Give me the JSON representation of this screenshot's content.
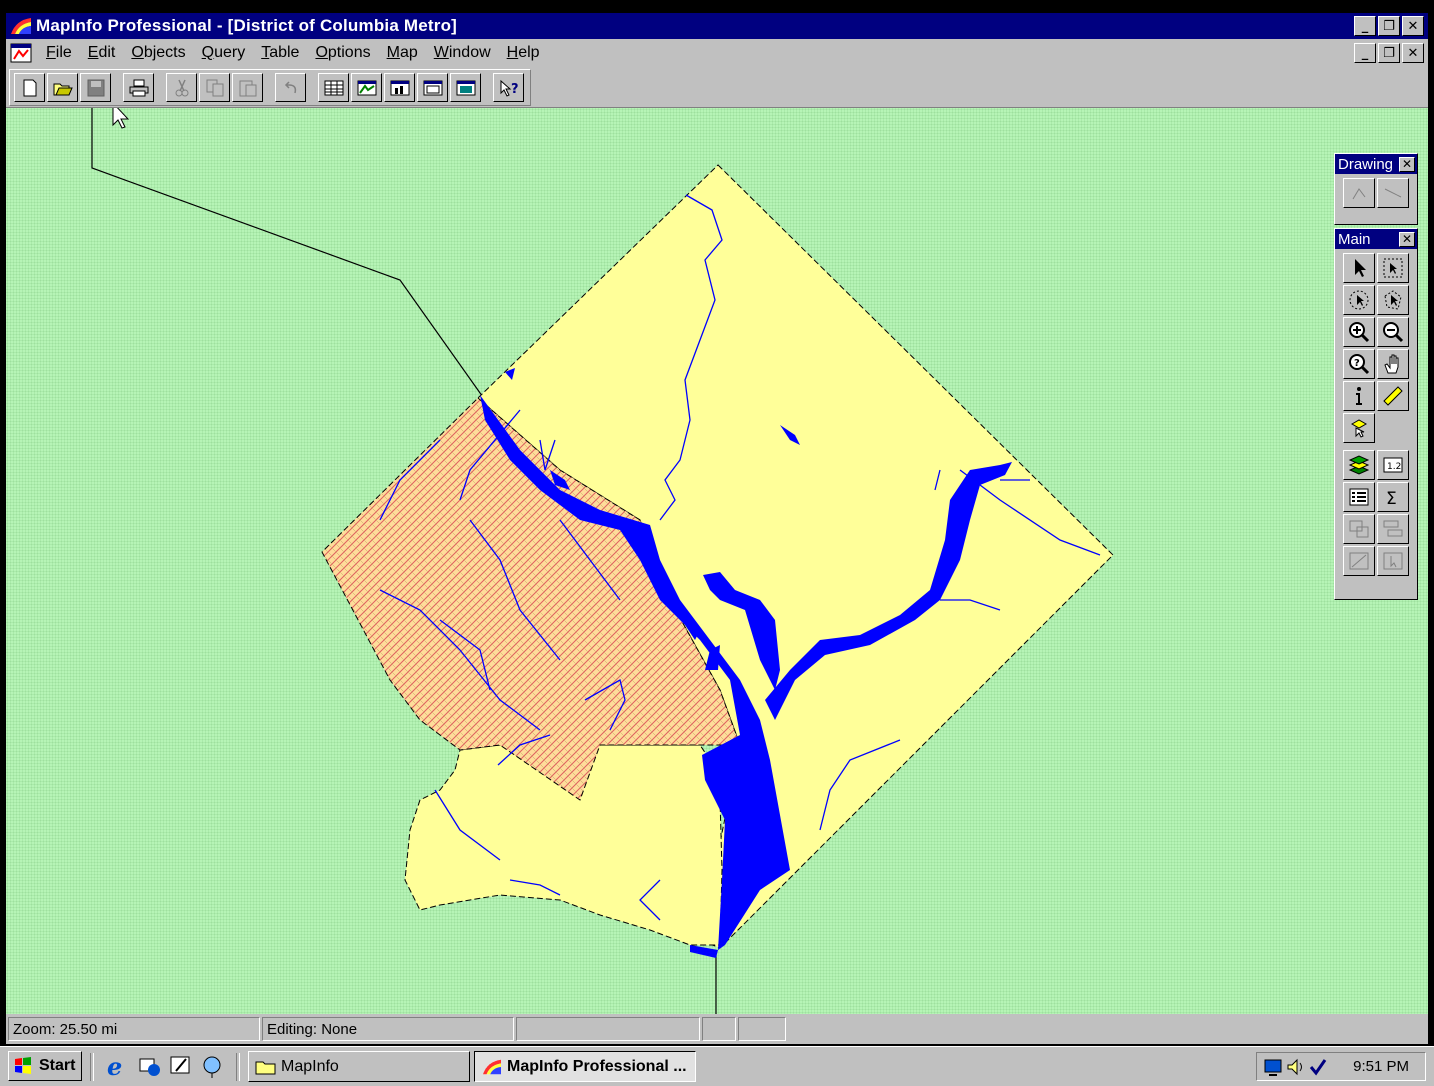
{
  "window": {
    "title": "MapInfo Professional - [District of Columbia Metro]",
    "minimize": "_",
    "restore": "❐",
    "close": "✕"
  },
  "menu": {
    "items": [
      {
        "label": "File",
        "accel": "F",
        "rest": "ile"
      },
      {
        "label": "Edit",
        "accel": "E",
        "rest": "dit"
      },
      {
        "label": "Objects",
        "accel": "O",
        "rest": "bjects"
      },
      {
        "label": "Query",
        "accel": "Q",
        "rest": "uery"
      },
      {
        "label": "Table",
        "accel": "T",
        "rest": "able"
      },
      {
        "label": "Options",
        "accel": "O",
        "rest": "ptions"
      },
      {
        "label": "Map",
        "accel": "M",
        "rest": "ap"
      },
      {
        "label": "Window",
        "accel": "W",
        "rest": "indow"
      },
      {
        "label": "Help",
        "accel": "H",
        "rest": "elp"
      }
    ]
  },
  "toolbar": {
    "buttons": [
      "new-icon",
      "open-icon",
      "save-icon",
      "print-icon",
      "cut-icon",
      "copy-icon",
      "paste-icon",
      "undo-icon",
      "new-browser-icon",
      "new-mapper-icon",
      "new-grapher-icon",
      "new-layout-icon",
      "new-redistrict-icon",
      "help-pointer-icon"
    ]
  },
  "palettes": {
    "drawing": {
      "title": "Drawing"
    },
    "main": {
      "title": "Main"
    }
  },
  "status": {
    "zoom": "Zoom: 25.50 mi",
    "editing": "Editing: None"
  },
  "taskbar": {
    "start": "Start",
    "mapinfo_folder": "MapInfo",
    "mapinfo_app": "MapInfo Professional ...",
    "clock": "9:51 PM"
  },
  "colors": {
    "titlebar": "#000080",
    "map_background": "#b6f4b6",
    "land": "#ffff99",
    "water": "#0000ff",
    "selected_hatch": "#e06060"
  }
}
